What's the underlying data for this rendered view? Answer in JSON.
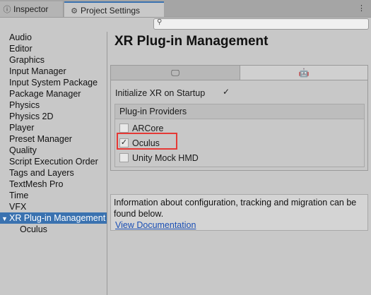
{
  "tabs": [
    {
      "label": "Inspector",
      "icon": "info-icon"
    },
    {
      "label": "Project Settings",
      "icon": "gear-icon"
    }
  ],
  "search": {
    "placeholder": "",
    "value": ""
  },
  "sidebar": {
    "items": [
      {
        "label": "Audio"
      },
      {
        "label": "Editor"
      },
      {
        "label": "Graphics"
      },
      {
        "label": "Input Manager"
      },
      {
        "label": "Input System Package"
      },
      {
        "label": "Package Manager"
      },
      {
        "label": "Physics"
      },
      {
        "label": "Physics 2D"
      },
      {
        "label": "Player"
      },
      {
        "label": "Preset Manager"
      },
      {
        "label": "Quality"
      },
      {
        "label": "Script Execution Order"
      },
      {
        "label": "Tags and Layers"
      },
      {
        "label": "TextMesh Pro"
      },
      {
        "label": "Time"
      },
      {
        "label": "VFX"
      },
      {
        "label": "XR Plug-in Management",
        "selected": true
      },
      {
        "label": "Oculus",
        "child": true
      }
    ]
  },
  "main": {
    "title": "XR Plug-in Management",
    "platform_tabs": [
      {
        "icon": "desktop-icon",
        "glyph": "🖵"
      },
      {
        "icon": "android-icon",
        "glyph": "🤖"
      }
    ],
    "init_label": "Initialize XR on Startup",
    "init_checked": true,
    "providers_header": "Plug-in Providers",
    "providers": [
      {
        "label": "ARCore",
        "checked": false
      },
      {
        "label": "Oculus",
        "checked": true
      },
      {
        "label": "Unity Mock HMD",
        "checked": false
      }
    ],
    "info_text": "Information about configuration, tracking and migration can be found below.",
    "info_link": "View Documentation"
  },
  "colors": {
    "selection": "#3a72b0",
    "highlight": "#e53935",
    "link": "#1a4fb5"
  }
}
